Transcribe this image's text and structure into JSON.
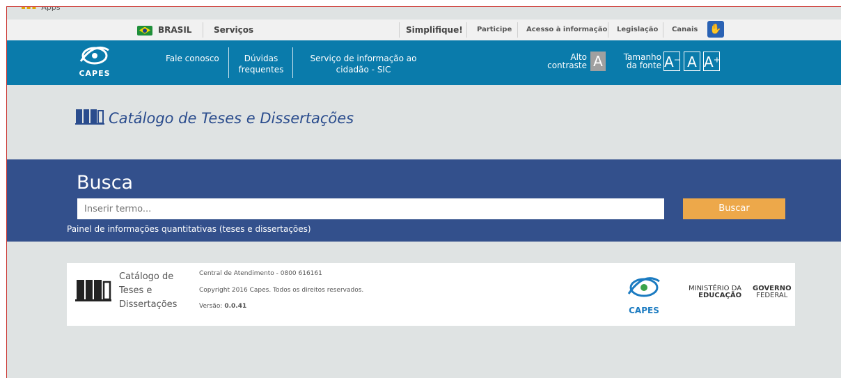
{
  "browser": {
    "apps_label": "Apps"
  },
  "govbar": {
    "brasil": "BRASIL",
    "servicos": "Serviços",
    "simplifique": "Simplifique!",
    "participe": "Participe",
    "acesso": "Acesso à informação",
    "legislacao": "Legislação",
    "canais": "Canais"
  },
  "header": {
    "logo_text": "CAPES",
    "links": {
      "fale": "Fale conosco",
      "duvidas_1": "Dúvidas",
      "duvidas_2": "frequentes",
      "sic_1": "Serviço de informação ao",
      "sic_2": "cidadão - SIC"
    },
    "alto_1": "Alto",
    "alto_2": "contraste",
    "alto_btn": "A",
    "tamanho_1": "Tamanho",
    "tamanho_2": "da fonte",
    "font_minus": "A⁻",
    "font_normal": "A",
    "font_plus": "A⁺"
  },
  "main": {
    "title": "Catálogo de Teses e Dissertações"
  },
  "busca": {
    "heading": "Busca",
    "placeholder": "Inserir termo...",
    "button": "Buscar",
    "painel": "Painel de informações quantitativas (teses e dissertações)"
  },
  "footer": {
    "name_1": "Catálogo de",
    "name_2": "Teses e",
    "name_3": "Dissertações",
    "central": "Central de Atendimento - 0800 616161",
    "copyright": "Copyright 2016 Capes. Todos os direitos reservados.",
    "versao_label": "Versão:",
    "versao": "0.0.41",
    "capes": "CAPES",
    "mec_1": "MINISTÉRIO DA",
    "mec_2": "EDUCAÇÃO",
    "gov_1": "GOVERNO",
    "gov_2": "FEDERAL"
  },
  "colors": {
    "header_blue": "#0a7bab",
    "busca_blue": "#33508c",
    "button_orange": "#eda84a",
    "title_blue": "#2a4c8d",
    "page_bg": "#dfe3e3"
  }
}
